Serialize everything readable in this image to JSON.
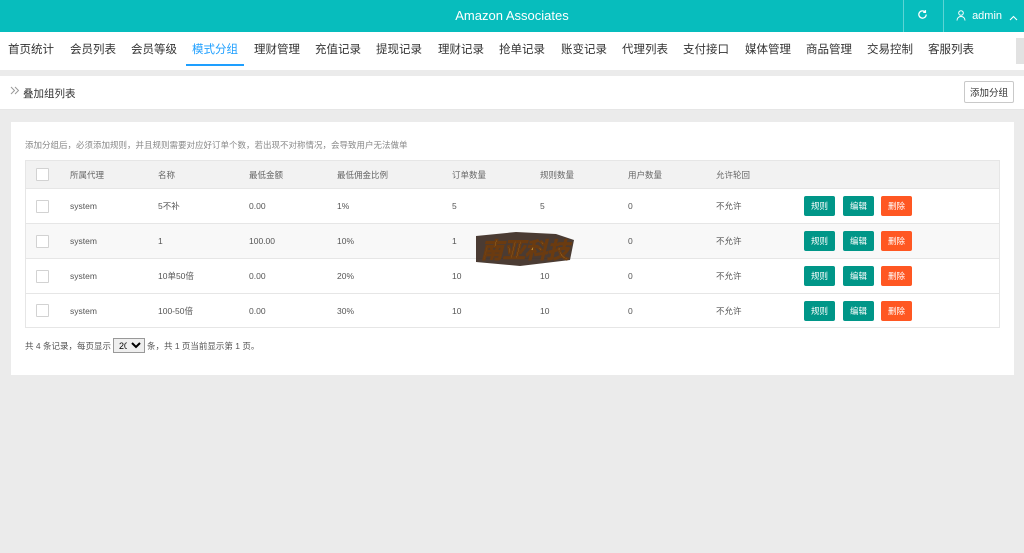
{
  "header": {
    "title": "Amazon Associates",
    "refresh_icon": "refresh-icon",
    "user_icon": "user-icon",
    "user_name": "admin",
    "dropdown_icon": "chevron-up-icon"
  },
  "nav": {
    "items": [
      "首页统计",
      "会员列表",
      "会员等级",
      "模式分组",
      "理财管理",
      "充值记录",
      "提现记录",
      "理财记录",
      "抢单记录",
      "账变记录",
      "代理列表",
      "支付接口",
      "媒体管理",
      "商品管理",
      "交易控制",
      "客服列表"
    ],
    "active_index": 3
  },
  "breadcrumb": {
    "icon": "double-chevron-right-icon",
    "text": "叠加组列表",
    "add_button": "添加分组"
  },
  "notice": "添加分组后，必须添加规则，并且规则需要对应好订单个数，若出现不对称情况，会导致用户无法做单",
  "table": {
    "headers": [
      "所属代理",
      "名称",
      "最低金额",
      "最低佣金比例",
      "订单数量",
      "规则数量",
      "用户数量",
      "允许轮回"
    ],
    "rows": [
      {
        "agent": "system",
        "name": "5不补",
        "min_amount": "0.00",
        "min_rate": "1%",
        "orders": "5",
        "rules": "5",
        "users": "0",
        "allow_loop": "不允许"
      },
      {
        "agent": "system",
        "name": "1",
        "min_amount": "100.00",
        "min_rate": "10%",
        "orders": "1",
        "rules": "",
        "users": "0",
        "allow_loop": "不允许"
      },
      {
        "agent": "system",
        "name": "10单50倍",
        "min_amount": "0.00",
        "min_rate": "20%",
        "orders": "10",
        "rules": "10",
        "users": "0",
        "allow_loop": "不允许"
      },
      {
        "agent": "system",
        "name": "100-50倍",
        "min_amount": "0.00",
        "min_rate": "30%",
        "orders": "10",
        "rules": "10",
        "users": "0",
        "allow_loop": "不允许"
      }
    ],
    "actions": {
      "rules": "规则",
      "edit": "编辑",
      "delete": "删除"
    }
  },
  "pager": {
    "prefix": "共 4 条记录，每页显示",
    "page_size": "20",
    "suffix": "条，共 1 页当前显示第 1 页。"
  },
  "watermark": {
    "text": "南亚科技"
  },
  "colors": {
    "header": "#07bdbd",
    "active_tab": "#1e9fff",
    "teal_button": "#009688",
    "orange_button": "#ff5722"
  }
}
